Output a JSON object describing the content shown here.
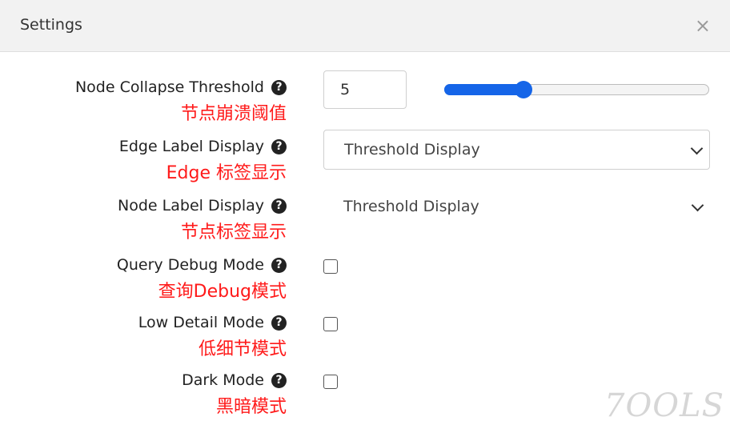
{
  "dialog": {
    "title": "Settings",
    "close_glyph": "×"
  },
  "settings": [
    {
      "label": "Node Collapse Threshold",
      "annotation": "节点崩溃阈值",
      "control": "number-slider",
      "value": "5",
      "slider_fraction": 0.3
    },
    {
      "label": "Edge Label Display",
      "annotation": "Edge 标签显示",
      "control": "select",
      "value": "Threshold Display"
    },
    {
      "label": "Node Label Display",
      "annotation": "节点标签显示",
      "control": "select",
      "value": "Threshold Display"
    },
    {
      "label": "Query Debug Mode",
      "annotation": "查询Debug模式",
      "control": "checkbox",
      "checked": false
    },
    {
      "label": "Low Detail Mode",
      "annotation": "低细节模式",
      "control": "checkbox",
      "checked": false
    },
    {
      "label": "Dark Mode",
      "annotation": "黑暗模式",
      "control": "checkbox",
      "checked": false
    }
  ],
  "help_glyph": "?",
  "icons": {
    "help": "question-circle-icon",
    "close": "close-icon",
    "select": "chevron-down-icon"
  },
  "colors": {
    "accent": "#1565e8",
    "annotation": "#ff1a1a",
    "header_bg": "#f2f2f2"
  },
  "watermark": "7OOLS"
}
